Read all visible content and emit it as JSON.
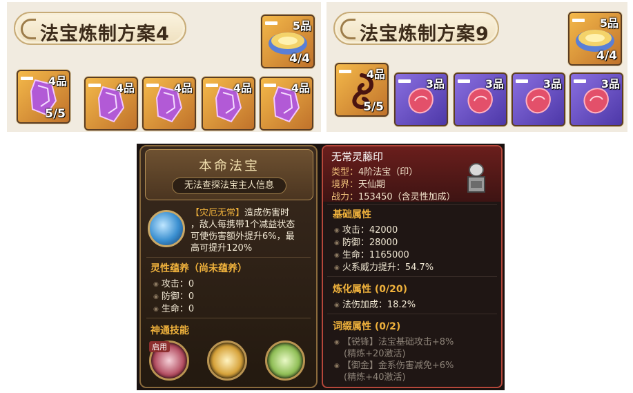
{
  "recipes": [
    {
      "title": "法宝炼制方案4",
      "main_item": {
        "tier": "5品",
        "count": "4/4",
        "icon": "golden-disc-icon"
      },
      "materials": [
        {
          "tier": "4品",
          "count": "5/5",
          "icon": "purple-crystal-icon"
        },
        {
          "tier": "4品",
          "count": "",
          "icon": "purple-crystal-icon"
        },
        {
          "tier": "4品",
          "count": "",
          "icon": "purple-crystal-icon"
        },
        {
          "tier": "4品",
          "count": "",
          "icon": "purple-crystal-icon"
        },
        {
          "tier": "4品",
          "count": "",
          "icon": "purple-crystal-icon"
        }
      ]
    },
    {
      "title": "法宝炼制方案9",
      "main_item": {
        "tier": "5品",
        "count": "4/4",
        "icon": "golden-disc-icon"
      },
      "materials": [
        {
          "tier": "4品",
          "count": "5/5",
          "icon": "dark-vine-icon"
        },
        {
          "tier": "3品",
          "count": "",
          "icon": "red-bean-icon"
        },
        {
          "tier": "3品",
          "count": "",
          "icon": "red-bean-icon"
        },
        {
          "tier": "3品",
          "count": "",
          "icon": "red-bean-icon"
        },
        {
          "tier": "3品",
          "count": "",
          "icon": "red-bean-icon"
        }
      ]
    }
  ],
  "fabao_panel": {
    "title": "本命法宝",
    "subtitle": "无法查探法宝主人信息",
    "skill": {
      "tag": "【灾厄无常】",
      "line1": "造成伤害时",
      "line2": "，敌人每携带1个减益状态",
      "line3": "可使伤害额外提升6%，最",
      "line4": "高可提升120%"
    },
    "nurture_title": "灵性蕴养（尚未蕴养）",
    "nurture_stats": [
      "攻击：0",
      "防御：0",
      "生命：0"
    ],
    "powers_title": "神通技能",
    "enabled_label": "启用"
  },
  "item_info": {
    "name": "无常灵藤印",
    "type_key": "类型：",
    "type_val": "4阶法宝（印）",
    "realm_key": "境界：",
    "realm_val": "天仙期",
    "power_key": "战力：",
    "power_val": "153450（含灵性加成）",
    "base_title": "基础属性",
    "base_stats": [
      "攻击：42000",
      "防御：28000",
      "生命：1165000",
      "火系威力提升：54.7%"
    ],
    "refine_title": "炼化属性 (0/20)",
    "refine_stats": [
      "法伤加成：18.2%"
    ],
    "affix_title": "词缀属性 (0/2)",
    "affix_1": "【锐锋】法宝基础攻击+8%",
    "affix_1_note": "(精炼+20激活)",
    "affix_2": "【御金】金系伤害减免+6%",
    "affix_2_note": "(精炼+40激活)"
  }
}
